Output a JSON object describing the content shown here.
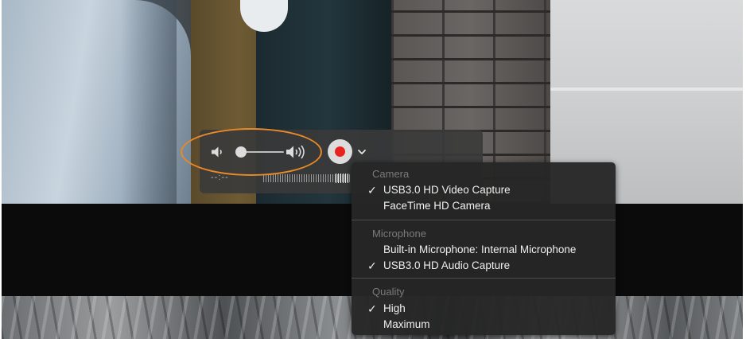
{
  "hud": {
    "time_label": "--:--",
    "volume_level": 0.1,
    "record_color": "#e8231f"
  },
  "menu": {
    "sections": [
      {
        "title": "Camera",
        "items": [
          {
            "label": "USB3.0 HD Video Capture",
            "checked": true
          },
          {
            "label": "FaceTime HD Camera",
            "checked": false
          }
        ]
      },
      {
        "title": "Microphone",
        "items": [
          {
            "label": "Built-in Microphone: Internal Microphone",
            "checked": false
          },
          {
            "label": "USB3.0 HD Audio Capture",
            "checked": true
          }
        ]
      },
      {
        "title": "Quality",
        "items": [
          {
            "label": "High",
            "checked": true
          },
          {
            "label": "Maximum",
            "checked": false
          }
        ]
      }
    ],
    "check_glyph": "✓"
  },
  "colors": {
    "annotation": "#e8892a",
    "menu_background": "#262626",
    "hud_background": "#3a3a3a"
  },
  "icons": {
    "volume_low": "speaker-low-icon",
    "volume_high": "speaker-high-icon",
    "record": "record-icon",
    "chevron": "chevron-down-icon",
    "check": "checkmark-icon"
  }
}
